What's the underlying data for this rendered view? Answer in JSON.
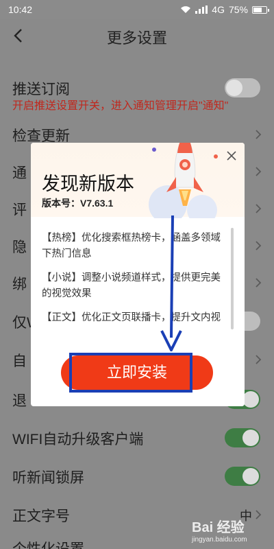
{
  "status_bar": {
    "time": "10:42",
    "network": "4G",
    "battery": "75%",
    "battery_level": 0.75
  },
  "header": {
    "title": "更多设置"
  },
  "settings": {
    "push": {
      "label": "推送订阅",
      "hint": "开启推送设置开关，进入通知管理开启\"通知\"",
      "toggle": "off"
    },
    "check_update": {
      "label": "检查更新"
    },
    "row3": {
      "label": "通"
    },
    "row4": {
      "label": "评"
    },
    "row5": {
      "label": "隐"
    },
    "row6": {
      "label": "绑"
    },
    "row7": {
      "label": "仅W",
      "toggle": "off"
    },
    "row8": {
      "label": "自"
    },
    "row9": {
      "label": "退",
      "toggle": "on"
    },
    "wifi_upgrade": {
      "label": "WIFI自动升级客户端",
      "toggle": "on"
    },
    "lock_screen": {
      "label": "听新闻锁屏",
      "toggle": "on"
    },
    "font_size": {
      "label": "正文字号",
      "value": "中"
    },
    "personalize": {
      "label": "个性化设置"
    }
  },
  "dialog": {
    "title": "发现新版本",
    "version_label": "版本号：V7.63.1",
    "notes": [
      "【热榜】优化搜索框热榜卡，涵盖多领域下热门信息",
      "【小说】调整小说频道样式，提供更完美的视觉效果",
      "【正文】优化正文页联播卡，提升文内视"
    ],
    "install_label": "立即安装"
  },
  "watermark": {
    "brand": "Bai 经验",
    "url": "jingyan.baidu.com"
  },
  "colors": {
    "accent_red": "#f03a17",
    "hint_red": "#c0281e",
    "toggle_on": "#3e7d44",
    "annotation_blue": "#1a3fb5"
  },
  "icons": [
    "wifi-icon",
    "signal-icon",
    "battery-icon",
    "back-arrow-icon",
    "chevron-right-icon",
    "close-icon",
    "rocket-icon"
  ]
}
